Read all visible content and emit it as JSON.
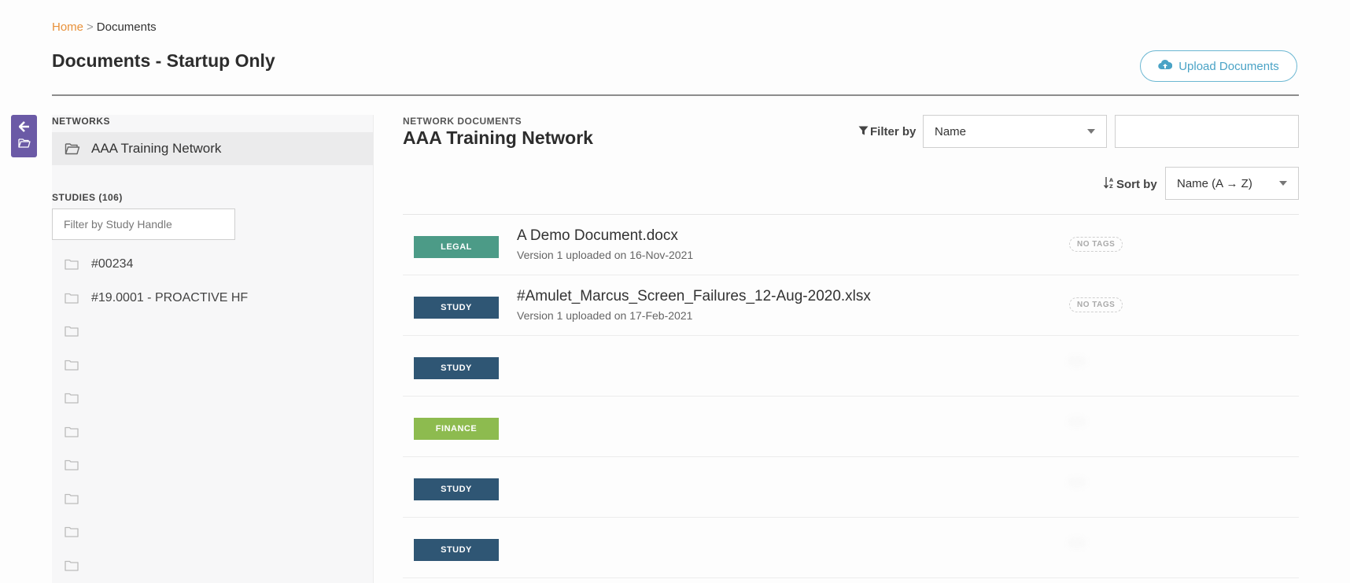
{
  "breadcrumb": {
    "home": "Home",
    "separator": ">",
    "current": "Documents"
  },
  "page": {
    "title": "Documents - Startup Only"
  },
  "upload": {
    "label": "Upload Documents",
    "icon": "cloud-upload-icon"
  },
  "sidebar": {
    "networks_label": "NETWORKS",
    "network_item": "AAA Training Network",
    "studies_label": "STUDIES (106)",
    "study_filter_placeholder": "Filter by Study Handle",
    "studies": [
      "#00234",
      "#19.0001 - PROACTIVE HF",
      "",
      "",
      "",
      "",
      "",
      "",
      "",
      ""
    ]
  },
  "main": {
    "label": "NETWORK DOCUMENTS",
    "title": "AAA Training Network",
    "filter_label": "Filter by",
    "filter_value": "Name",
    "sort_label": "Sort by",
    "sort_value": "Name (A → Z)"
  },
  "documents": [
    {
      "category": "LEGAL",
      "name": "A Demo Document.docx",
      "version_label": "Version 1",
      "uploaded_text": "uploaded on 16-Nov-2021",
      "tag": "NO TAGS"
    },
    {
      "category": "STUDY",
      "name": "#Amulet_Marcus_Screen_Failures_12-Aug-2020.xlsx",
      "version_label": "Version 1",
      "uploaded_text": "uploaded on 17-Feb-2021",
      "tag": "NO TAGS"
    },
    {
      "category": "STUDY",
      "name": "",
      "version_label": "",
      "uploaded_text": "",
      "tag": ""
    },
    {
      "category": "FINANCE",
      "name": "",
      "version_label": "",
      "uploaded_text": "",
      "tag": ""
    },
    {
      "category": "STUDY",
      "name": "",
      "version_label": "",
      "uploaded_text": "",
      "tag": ""
    },
    {
      "category": "STUDY",
      "name": "",
      "version_label": "",
      "uploaded_text": "",
      "tag": ""
    }
  ],
  "colors": {
    "accent": "#4aa3c6",
    "home_link": "#e8913a",
    "toggle": "#6b5aa6",
    "legal": "#4c9b87",
    "study": "#2f5674",
    "finance": "#8dbb4f"
  }
}
